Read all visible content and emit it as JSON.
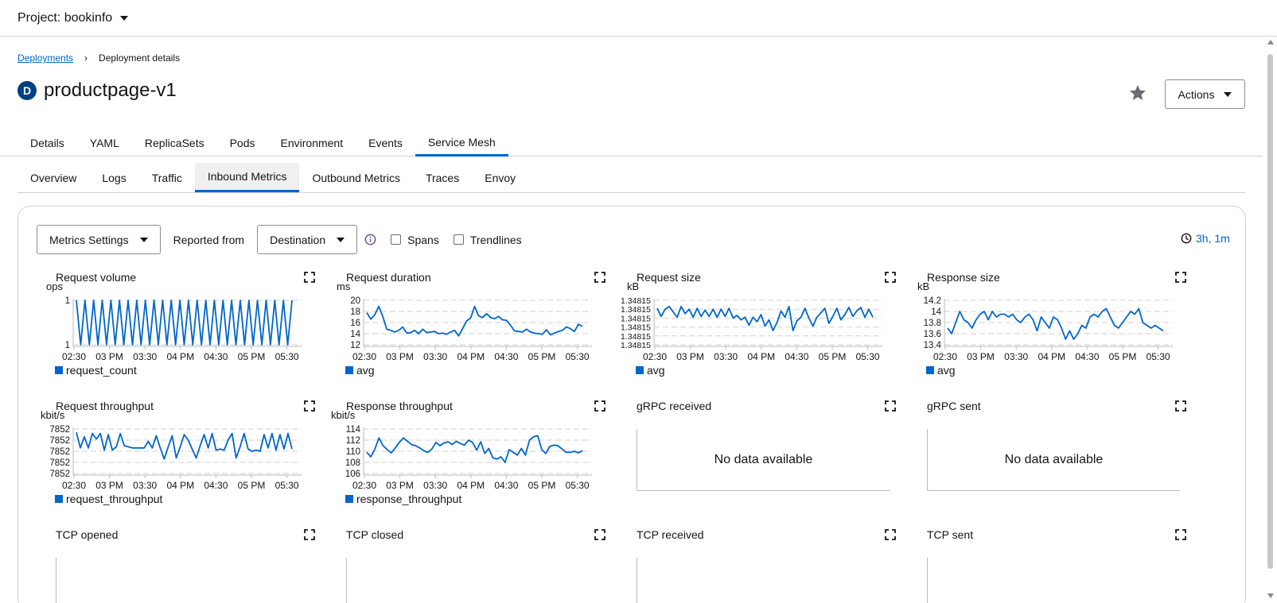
{
  "header": {
    "project_label": "Project: bookinfo"
  },
  "breadcrumb": {
    "parent": "Deployments",
    "current": "Deployment details"
  },
  "page": {
    "badge": "D",
    "title": "productpage-v1",
    "actions_label": "Actions"
  },
  "tabs": [
    {
      "label": "Details"
    },
    {
      "label": "YAML"
    },
    {
      "label": "ReplicaSets"
    },
    {
      "label": "Pods"
    },
    {
      "label": "Environment"
    },
    {
      "label": "Events"
    },
    {
      "label": "Service Mesh"
    }
  ],
  "active_tab": "Service Mesh",
  "subtabs": [
    {
      "label": "Overview"
    },
    {
      "label": "Logs"
    },
    {
      "label": "Traffic"
    },
    {
      "label": "Inbound Metrics"
    },
    {
      "label": "Outbound Metrics"
    },
    {
      "label": "Traces"
    },
    {
      "label": "Envoy"
    }
  ],
  "active_subtab": "Inbound Metrics",
  "toolbar": {
    "metrics_settings": "Metrics Settings",
    "reported_from_label": "Reported from",
    "reported_from_value": "Destination",
    "spans_label": "Spans",
    "trendlines_label": "Trendlines",
    "time_range": "3h, 1m"
  },
  "no_data_text": "No data available",
  "colors": {
    "accent": "#0066cc",
    "badge": "#004080"
  },
  "x_ticks": [
    "02:30",
    "03 PM",
    "03:30",
    "04 PM",
    "04:30",
    "05 PM",
    "05:30"
  ],
  "chart_data": [
    {
      "type": "line",
      "title": "Request volume",
      "ylabel": "ops",
      "y_ticks": [
        "1",
        "1"
      ],
      "ylim": [
        0,
        1
      ],
      "series": [
        {
          "name": "request_count",
          "values": [
            1,
            0,
            1,
            0,
            1,
            0,
            1,
            0,
            1,
            0,
            1,
            0,
            1,
            0,
            1,
            0,
            1,
            0,
            1,
            0,
            1,
            0,
            1,
            0,
            1,
            0,
            1,
            0,
            1,
            0,
            1,
            0,
            1,
            0,
            1,
            0,
            1,
            0,
            1,
            0,
            1,
            0,
            1,
            0,
            1,
            0,
            1,
            0,
            1,
            0,
            1
          ]
        }
      ]
    },
    {
      "type": "line",
      "title": "Request duration",
      "ylabel": "ms",
      "y_ticks": [
        "20",
        "18",
        "16",
        "14",
        "12"
      ],
      "ylim": [
        12,
        20
      ],
      "series": [
        {
          "name": "avg",
          "values": [
            17.8,
            16.6,
            17.4,
            18.9,
            17.1,
            14.8,
            14.6,
            14.3,
            14.6,
            15.2,
            14.1,
            14.2,
            14.6,
            14.0,
            14.8,
            14.2,
            14.3,
            14.4,
            14.0,
            14.1,
            13.9,
            14.3,
            14.6,
            13.6,
            14.9,
            16.3,
            16.8,
            18.9,
            17.2,
            16.9,
            17.6,
            16.9,
            16.7,
            17.1,
            16.5,
            16.4,
            15.5,
            14.5,
            14.4,
            14.3,
            14.8,
            14.3,
            14.1,
            14.0,
            13.9,
            14.7,
            13.8,
            14.1,
            14.4,
            14.6,
            15.2,
            14.9,
            14.4,
            15.7,
            15.3
          ]
        }
      ]
    },
    {
      "type": "line",
      "title": "Request size",
      "ylabel": "kB",
      "y_ticks": [
        "1.34815",
        "1.34815",
        "1.34815",
        "1.34815",
        "1.34815",
        "1.34815"
      ],
      "ylim": [
        0,
        5
      ],
      "series": [
        {
          "name": "avg",
          "values": [
            4.1,
            3.2,
            4.0,
            4.3,
            3.7,
            3.1,
            4.3,
            3.5,
            4.0,
            3.1,
            4.1,
            3.2,
            3.9,
            3.2,
            4.0,
            3.1,
            4.0,
            3.2,
            4.1,
            3.0,
            3.3,
            2.8,
            3.1,
            2.2,
            3.1,
            2.6,
            3.4,
            2.1,
            2.8,
            1.6,
            2.5,
            3.8,
            3.1,
            4.3,
            1.6,
            2.7,
            3.1,
            4.1,
            3.0,
            2.1,
            3.1,
            3.6,
            4.1,
            2.4,
            3.2,
            4.1,
            2.8,
            3.4,
            4.2,
            3.2,
            3.8,
            4.2,
            3.1,
            4.0,
            3.1
          ]
        }
      ]
    },
    {
      "type": "line",
      "title": "Response size",
      "ylabel": "kB",
      "y_ticks": [
        "14.2",
        "14",
        "13.8",
        "13.6",
        "13.4"
      ],
      "ylim": [
        13.4,
        14.2
      ],
      "series": [
        {
          "name": "avg",
          "values": [
            13.7,
            13.6,
            13.8,
            14.0,
            13.85,
            13.8,
            13.7,
            13.85,
            13.95,
            14.0,
            13.85,
            14.0,
            13.9,
            13.95,
            13.95,
            13.9,
            13.95,
            13.85,
            13.8,
            13.9,
            13.95,
            13.85,
            13.65,
            13.9,
            13.8,
            13.7,
            13.9,
            13.85,
            13.7,
            13.5,
            13.65,
            13.5,
            13.6,
            13.75,
            13.7,
            13.9,
            13.95,
            13.9,
            14.0,
            14.05,
            13.9,
            13.75,
            13.7,
            13.8,
            13.9,
            14.0,
            13.95,
            14.05,
            13.8,
            13.75,
            13.7,
            13.75,
            13.7,
            13.65
          ]
        }
      ]
    },
    {
      "type": "line",
      "title": "Request throughput",
      "ylabel": "kbit/s",
      "y_ticks": [
        "7852",
        "7852",
        "7852",
        "7852",
        "7852"
      ],
      "ylim": [
        0,
        4
      ],
      "series": [
        {
          "name": "request_throughput",
          "values": [
            3.7,
            2.3,
            3.3,
            2.3,
            3.6,
            3.1,
            3.6,
            2.1,
            3.5,
            2.1,
            2.4,
            3.6,
            2.5,
            2.4,
            2.3,
            2.3,
            2.3,
            2.3,
            2.9,
            2.3,
            3.4,
            2.3,
            1.3,
            2.4,
            3.4,
            1.4,
            2.4,
            3.5,
            3.0,
            2.2,
            1.4,
            2.5,
            3.5,
            2.3,
            3.6,
            2.1,
            2.2,
            2.1,
            3.0,
            3.6,
            1.4,
            2.4,
            3.6,
            2.2,
            2.0,
            2.1,
            2.0,
            3.5,
            2.3,
            3.6,
            2.1,
            3.5,
            2.2,
            3.6,
            2.2
          ]
        }
      ]
    },
    {
      "type": "line",
      "title": "Response throughput",
      "ylabel": "kbit/s",
      "y_ticks": [
        "114",
        "112",
        "110",
        "108",
        "106"
      ],
      "ylim": [
        106,
        114
      ],
      "series": [
        {
          "name": "response_throughput",
          "values": [
            109.8,
            109.0,
            110.4,
            112.4,
            111.0,
            110.3,
            109.7,
            110.6,
            111.6,
            112.4,
            111.8,
            111.2,
            111.0,
            110.6,
            110.1,
            109.8,
            110.4,
            111.6,
            111.0,
            111.5,
            111.7,
            111.2,
            111.8,
            111.4,
            111.1,
            112.0,
            111.6,
            110.2,
            111.7,
            109.6,
            110.5,
            108.8,
            108.6,
            109.0,
            108.0,
            110.3,
            109.8,
            109.3,
            110.5,
            109.3,
            112.0,
            112.6,
            112.8,
            110.3,
            109.6,
            110.9,
            111.1,
            111.0,
            110.4,
            109.8,
            109.8,
            110.0,
            109.7,
            110.1
          ]
        }
      ]
    },
    {
      "type": "line",
      "title": "gRPC received",
      "series": []
    },
    {
      "type": "line",
      "title": "gRPC sent",
      "series": []
    },
    {
      "type": "line",
      "title": "TCP opened",
      "series": []
    },
    {
      "type": "line",
      "title": "TCP closed",
      "series": []
    },
    {
      "type": "line",
      "title": "TCP received",
      "series": []
    },
    {
      "type": "line",
      "title": "TCP sent",
      "series": []
    }
  ]
}
